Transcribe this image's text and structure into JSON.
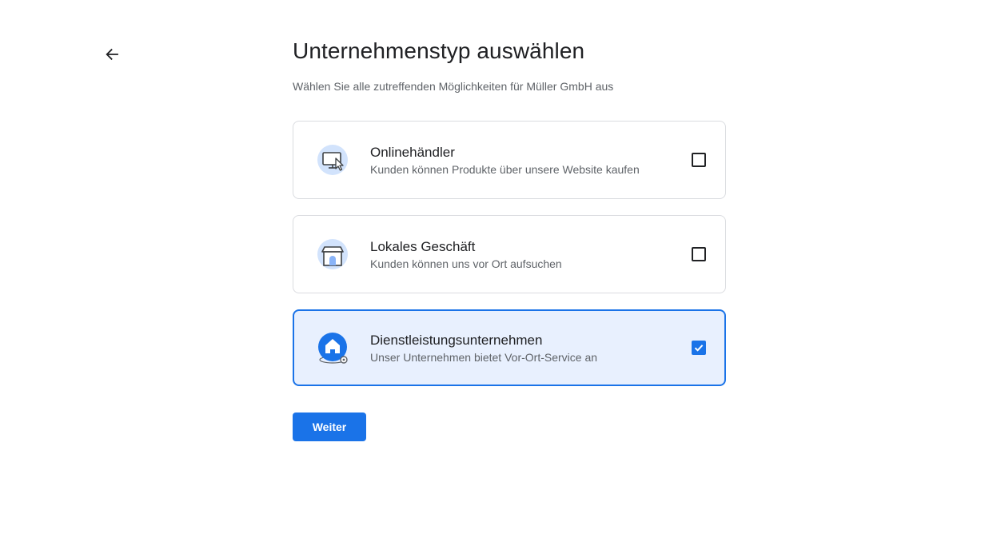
{
  "header": {
    "back_icon": "arrow-left-icon",
    "title": "Unternehmenstyp auswählen",
    "subtitle": "Wählen Sie alle zutreffenden Möglichkeiten für Müller GmbH aus"
  },
  "options": [
    {
      "icon": "online-store-monitor-icon",
      "title": "Onlinehändler",
      "description": "Kunden können Produkte über unsere Website kaufen",
      "checked": false
    },
    {
      "icon": "local-store-icon",
      "title": "Lokales Geschäft",
      "description": "Kunden können uns vor Ort aufsuchen",
      "checked": false
    },
    {
      "icon": "service-area-home-icon",
      "title": "Dienstleistungsunternehmen",
      "description": "Unser Unternehmen bietet Vor-Ort-Service an",
      "checked": true
    }
  ],
  "actions": {
    "next_label": "Weiter"
  },
  "colors": {
    "accent": "#1a73e8",
    "selected_bg": "#e8f0fe",
    "border": "#dadce0",
    "text_primary": "#202124",
    "text_secondary": "#5f6368"
  }
}
